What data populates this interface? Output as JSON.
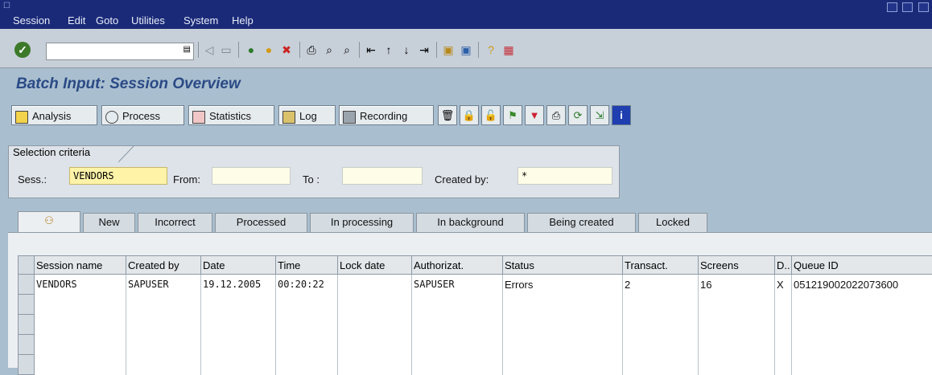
{
  "menu": {
    "items": [
      "Session",
      "Edit",
      "Goto",
      "Utilities",
      "System",
      "Help"
    ]
  },
  "toolbar": {
    "command_value": "",
    "icons": [
      "enter-icon",
      "command-dropdown-icon",
      "back-icon",
      "save-icon",
      "back-green-icon",
      "exit-icon",
      "cancel-icon",
      "print-icon",
      "find-icon",
      "find-next-icon",
      "first-page-icon",
      "prev-page-icon",
      "next-page-icon",
      "last-page-icon",
      "create-session-icon",
      "shortcut-icon",
      "help-icon",
      "layout-icon"
    ]
  },
  "title": "Batch Input: Session Overview",
  "app_toolbar": {
    "analysis": "Analysis",
    "process": "Process",
    "statistics": "Statistics",
    "log": "Log",
    "recording": "Recording",
    "icon_buttons": [
      "delete-icon",
      "lock-icon",
      "unlock-icon",
      "flag-icon",
      "filter-icon",
      "print-icon",
      "refresh-icon",
      "export-icon",
      "info-icon"
    ]
  },
  "selection": {
    "group_title": "Selection criteria",
    "sess_label": "Sess.:",
    "sess_value": "VENDORS",
    "from_label": "From:",
    "from_value": "",
    "to_label": "To :",
    "to_value": "",
    "created_by_label": "Created by:",
    "created_by_value": "*"
  },
  "tabs": [
    "",
    "New",
    "Incorrect",
    "Processed",
    "In processing",
    "In background",
    "Being created",
    "Locked"
  ],
  "table": {
    "columns": [
      "Session name",
      "Created by",
      "Date",
      "Time",
      "Lock date",
      "Authorizat.",
      "Status",
      "Transact.",
      "Screens",
      "D..",
      "Queue ID"
    ],
    "rows": [
      [
        "VENDORS",
        "SAPUSER",
        "19.12.2005",
        "00:20:22",
        "",
        "SAPUSER",
        "Errors",
        "2",
        "16",
        "X",
        "051219002022073600"
      ]
    ]
  },
  "colors": {
    "menubar": "#1b2a78",
    "title": "#2b4a86",
    "background": "#a9bfcf"
  }
}
